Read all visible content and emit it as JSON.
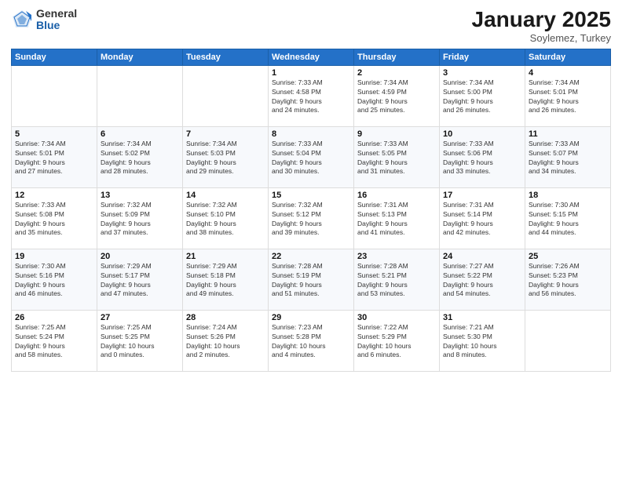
{
  "logo": {
    "general": "General",
    "blue": "Blue"
  },
  "header": {
    "month": "January 2025",
    "location": "Soylemez, Turkey"
  },
  "days_of_week": [
    "Sunday",
    "Monday",
    "Tuesday",
    "Wednesday",
    "Thursday",
    "Friday",
    "Saturday"
  ],
  "weeks": [
    [
      {
        "day": "",
        "info": ""
      },
      {
        "day": "",
        "info": ""
      },
      {
        "day": "",
        "info": ""
      },
      {
        "day": "1",
        "info": "Sunrise: 7:33 AM\nSunset: 4:58 PM\nDaylight: 9 hours\nand 24 minutes."
      },
      {
        "day": "2",
        "info": "Sunrise: 7:34 AM\nSunset: 4:59 PM\nDaylight: 9 hours\nand 25 minutes."
      },
      {
        "day": "3",
        "info": "Sunrise: 7:34 AM\nSunset: 5:00 PM\nDaylight: 9 hours\nand 26 minutes."
      },
      {
        "day": "4",
        "info": "Sunrise: 7:34 AM\nSunset: 5:01 PM\nDaylight: 9 hours\nand 26 minutes."
      }
    ],
    [
      {
        "day": "5",
        "info": "Sunrise: 7:34 AM\nSunset: 5:01 PM\nDaylight: 9 hours\nand 27 minutes."
      },
      {
        "day": "6",
        "info": "Sunrise: 7:34 AM\nSunset: 5:02 PM\nDaylight: 9 hours\nand 28 minutes."
      },
      {
        "day": "7",
        "info": "Sunrise: 7:34 AM\nSunset: 5:03 PM\nDaylight: 9 hours\nand 29 minutes."
      },
      {
        "day": "8",
        "info": "Sunrise: 7:33 AM\nSunset: 5:04 PM\nDaylight: 9 hours\nand 30 minutes."
      },
      {
        "day": "9",
        "info": "Sunrise: 7:33 AM\nSunset: 5:05 PM\nDaylight: 9 hours\nand 31 minutes."
      },
      {
        "day": "10",
        "info": "Sunrise: 7:33 AM\nSunset: 5:06 PM\nDaylight: 9 hours\nand 33 minutes."
      },
      {
        "day": "11",
        "info": "Sunrise: 7:33 AM\nSunset: 5:07 PM\nDaylight: 9 hours\nand 34 minutes."
      }
    ],
    [
      {
        "day": "12",
        "info": "Sunrise: 7:33 AM\nSunset: 5:08 PM\nDaylight: 9 hours\nand 35 minutes."
      },
      {
        "day": "13",
        "info": "Sunrise: 7:32 AM\nSunset: 5:09 PM\nDaylight: 9 hours\nand 37 minutes."
      },
      {
        "day": "14",
        "info": "Sunrise: 7:32 AM\nSunset: 5:10 PM\nDaylight: 9 hours\nand 38 minutes."
      },
      {
        "day": "15",
        "info": "Sunrise: 7:32 AM\nSunset: 5:12 PM\nDaylight: 9 hours\nand 39 minutes."
      },
      {
        "day": "16",
        "info": "Sunrise: 7:31 AM\nSunset: 5:13 PM\nDaylight: 9 hours\nand 41 minutes."
      },
      {
        "day": "17",
        "info": "Sunrise: 7:31 AM\nSunset: 5:14 PM\nDaylight: 9 hours\nand 42 minutes."
      },
      {
        "day": "18",
        "info": "Sunrise: 7:30 AM\nSunset: 5:15 PM\nDaylight: 9 hours\nand 44 minutes."
      }
    ],
    [
      {
        "day": "19",
        "info": "Sunrise: 7:30 AM\nSunset: 5:16 PM\nDaylight: 9 hours\nand 46 minutes."
      },
      {
        "day": "20",
        "info": "Sunrise: 7:29 AM\nSunset: 5:17 PM\nDaylight: 9 hours\nand 47 minutes."
      },
      {
        "day": "21",
        "info": "Sunrise: 7:29 AM\nSunset: 5:18 PM\nDaylight: 9 hours\nand 49 minutes."
      },
      {
        "day": "22",
        "info": "Sunrise: 7:28 AM\nSunset: 5:19 PM\nDaylight: 9 hours\nand 51 minutes."
      },
      {
        "day": "23",
        "info": "Sunrise: 7:28 AM\nSunset: 5:21 PM\nDaylight: 9 hours\nand 53 minutes."
      },
      {
        "day": "24",
        "info": "Sunrise: 7:27 AM\nSunset: 5:22 PM\nDaylight: 9 hours\nand 54 minutes."
      },
      {
        "day": "25",
        "info": "Sunrise: 7:26 AM\nSunset: 5:23 PM\nDaylight: 9 hours\nand 56 minutes."
      }
    ],
    [
      {
        "day": "26",
        "info": "Sunrise: 7:25 AM\nSunset: 5:24 PM\nDaylight: 9 hours\nand 58 minutes."
      },
      {
        "day": "27",
        "info": "Sunrise: 7:25 AM\nSunset: 5:25 PM\nDaylight: 10 hours\nand 0 minutes."
      },
      {
        "day": "28",
        "info": "Sunrise: 7:24 AM\nSunset: 5:26 PM\nDaylight: 10 hours\nand 2 minutes."
      },
      {
        "day": "29",
        "info": "Sunrise: 7:23 AM\nSunset: 5:28 PM\nDaylight: 10 hours\nand 4 minutes."
      },
      {
        "day": "30",
        "info": "Sunrise: 7:22 AM\nSunset: 5:29 PM\nDaylight: 10 hours\nand 6 minutes."
      },
      {
        "day": "31",
        "info": "Sunrise: 7:21 AM\nSunset: 5:30 PM\nDaylight: 10 hours\nand 8 minutes."
      },
      {
        "day": "",
        "info": ""
      }
    ]
  ]
}
